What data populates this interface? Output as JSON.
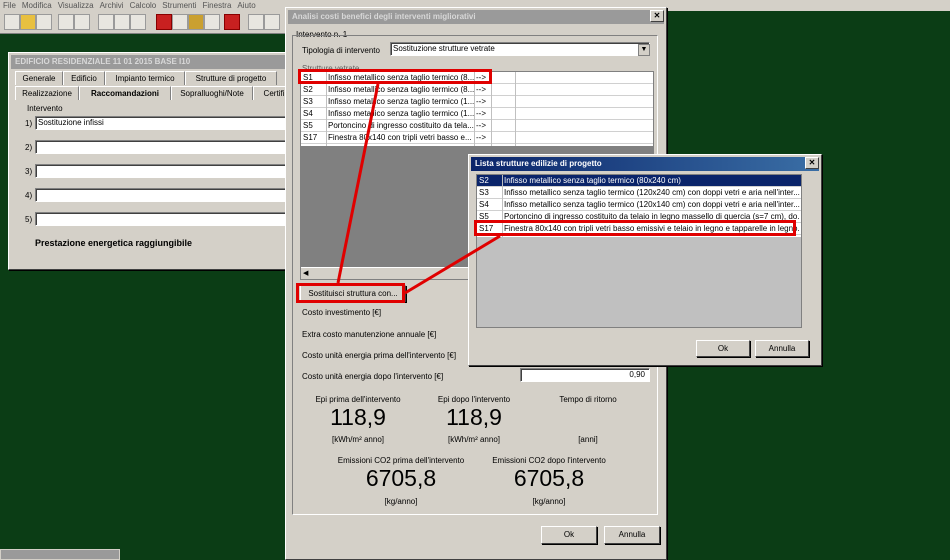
{
  "menu": [
    "File",
    "Modifica",
    "Visualizza",
    "Archivi",
    "Calcolo",
    "Strumenti",
    "Finestra",
    "Aiuto"
  ],
  "building_window": {
    "title": "EDIFICIO RESIDENZIALE 11 01 2015 BASE I10",
    "tabs_row1": [
      "Generale",
      "Edificio",
      "Impianto termico",
      "Strutture di progetto"
    ],
    "tabs_row2": [
      "Realizzazione",
      "Raccomandazioni",
      "Sopralluoghi/Note",
      "Certifi"
    ],
    "intervento_label": "Intervento",
    "rows": [
      {
        "num": "1)",
        "value": "Sostituzione infissi"
      },
      {
        "num": "2)",
        "value": ""
      },
      {
        "num": "3)",
        "value": ""
      },
      {
        "num": "4)",
        "value": ""
      },
      {
        "num": "5)",
        "value": ""
      }
    ],
    "prestazione_label": "Prestazione energetica raggiungibile"
  },
  "analysis_window": {
    "title": "Analisi costi benefici degli interventi migliorativi",
    "intervento_group": "Intervento n. 1",
    "tipologia_label": "Tipologia di intervento",
    "tipologia_value": "Sostituzione strutture vetrate",
    "strutture_group": "Strutture vetrate",
    "rows": [
      {
        "code": "S1",
        "desc": "Infisso metallico senza taglio termico (8...",
        "arrow": "-->"
      },
      {
        "code": "S2",
        "desc": "Infisso metallico senza taglio termico (8...",
        "arrow": "-->"
      },
      {
        "code": "S3",
        "desc": "Infisso metallico senza taglio termico (1...",
        "arrow": "-->"
      },
      {
        "code": "S4",
        "desc": "Infisso metallico senza taglio termico (1...",
        "arrow": "-->"
      },
      {
        "code": "S5",
        "desc": "Portoncino di ingresso costituito da tela...",
        "arrow": "-->"
      },
      {
        "code": "S17",
        "desc": "Finestra 80x140 con tripli vetri basso e...",
        "arrow": "-->"
      }
    ],
    "replace_button": "Sostituisci struttura con...",
    "costo_investimento": "Costo investimento [€]",
    "extra_costo": "Extra costo manutenzione annuale [€]",
    "costo_prima": "Costo unità energia prima dell'intervento [€]",
    "costo_dopo": "Costo unità energia dopo l'intervento [€]",
    "costo_dopo_value": "0,90",
    "epi_prima_label": "Epi prima dell'intervento",
    "epi_prima_value": "118,9",
    "epi_dopo_label": "Epi dopo l'intervento",
    "epi_dopo_value": "118,9",
    "epi_unit": "[kWh/m² anno]",
    "tempo_label": "Tempo di ritorno",
    "tempo_unit": "[anni]",
    "co2_prima_label": "Emissioni CO2 prima dell'intervento",
    "co2_prima_value": "6705,8",
    "co2_dopo_label": "Emissioni CO2 dopo l'intervento",
    "co2_dopo_value": "6705,8",
    "co2_unit": "[kg/anno]",
    "ok": "Ok",
    "cancel": "Annulla"
  },
  "list_dialog": {
    "title": "Lista strutture edilizie di progetto",
    "rows": [
      {
        "code": "S2",
        "desc": "Infisso metallico senza taglio termico (80x240 cm)"
      },
      {
        "code": "S3",
        "desc": "Infisso metallico senza taglio termico (120x240 cm) con doppi vetri e aria nell'inter..."
      },
      {
        "code": "S4",
        "desc": "Infisso metallico senza taglio termico (120x140 cm) con doppi vetri e aria nell'inter..."
      },
      {
        "code": "S5",
        "desc": "Portoncino di ingresso costituito da telaio in legno massello di quercia (s=7 cm), do..."
      },
      {
        "code": "S17",
        "desc": "Finestra 80x140 con tripli vetri basso emissivi e telaio in legno e tapparelle in legno."
      }
    ],
    "ok": "Ok",
    "cancel": "Annulla"
  }
}
